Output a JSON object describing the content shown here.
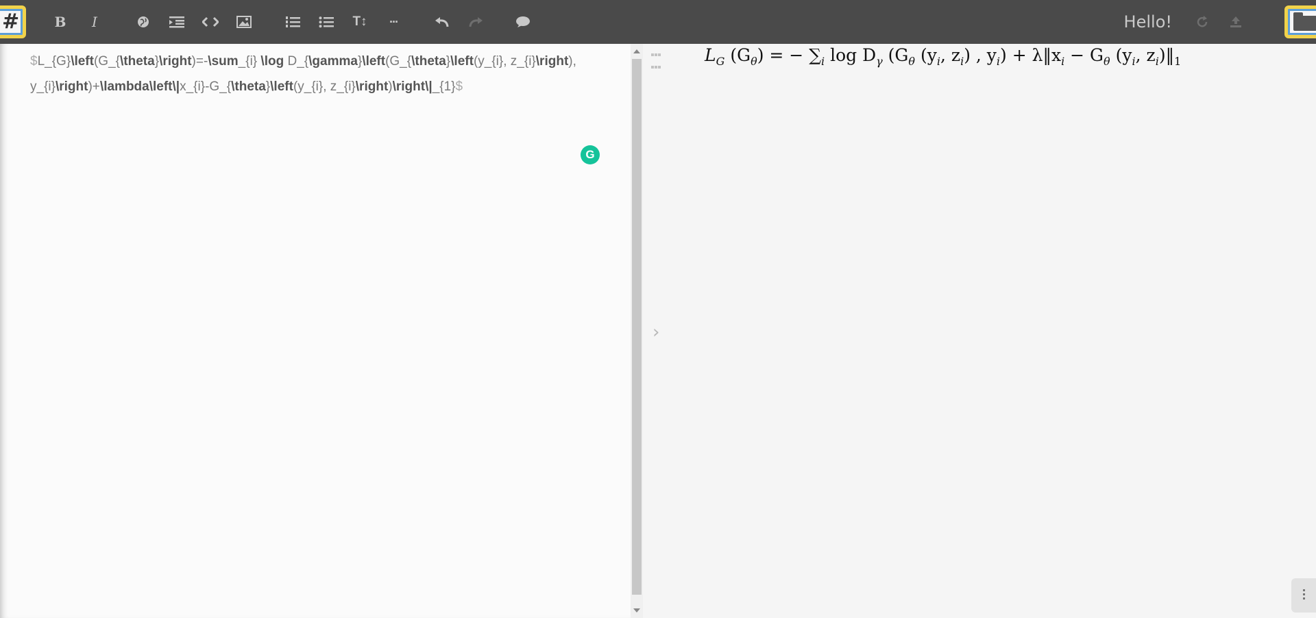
{
  "toolbar": {
    "buttons": [
      "bold",
      "italic",
      "link",
      "indent",
      "code",
      "image",
      "ordered-list",
      "bullet-list",
      "heading",
      "more",
      "undo",
      "redo",
      "comment"
    ],
    "bold_glyph": "B",
    "italic_glyph": "I",
    "heading_glyph": "T↕",
    "more_glyph": "···"
  },
  "corner_left": {
    "glyph": "#"
  },
  "greeting": "Hello!",
  "editor": {
    "segments": [
      {
        "t": "$",
        "c": "dollar"
      },
      {
        "t": "L_{G}",
        "c": ""
      },
      {
        "t": "\\left",
        "c": "kw"
      },
      {
        "t": "(G_{",
        "c": ""
      },
      {
        "t": "\\theta",
        "c": "kw"
      },
      {
        "t": "}",
        "c": ""
      },
      {
        "t": "\\right",
        "c": "kw"
      },
      {
        "t": ")=-",
        "c": ""
      },
      {
        "t": "\\sum",
        "c": "kw"
      },
      {
        "t": "_{i} ",
        "c": ""
      },
      {
        "t": "\\log",
        "c": "kw"
      },
      {
        "t": " D_{",
        "c": ""
      },
      {
        "t": "\\gamma",
        "c": "kw"
      },
      {
        "t": "}",
        "c": ""
      },
      {
        "t": "\\left",
        "c": "kw"
      },
      {
        "t": "(G_{",
        "c": ""
      },
      {
        "t": "\\theta",
        "c": "kw"
      },
      {
        "t": "}",
        "c": ""
      },
      {
        "t": "\\left",
        "c": "kw"
      },
      {
        "t": "(y_{i}, z_{i}",
        "c": ""
      },
      {
        "t": "\\right",
        "c": "kw"
      },
      {
        "t": "), y_{i}",
        "c": ""
      },
      {
        "t": "\\right",
        "c": "kw"
      },
      {
        "t": ")+",
        "c": ""
      },
      {
        "t": "\\lambda",
        "c": "kw"
      },
      {
        "t": "\\left\\|",
        "c": "kw"
      },
      {
        "t": "x_{i}-G_{",
        "c": ""
      },
      {
        "t": "\\theta",
        "c": "kw"
      },
      {
        "t": "}",
        "c": ""
      },
      {
        "t": "\\left",
        "c": "kw"
      },
      {
        "t": "(y_{i}, z_{i}",
        "c": ""
      },
      {
        "t": "\\right",
        "c": "kw"
      },
      {
        "t": ")",
        "c": ""
      },
      {
        "t": "\\right\\|",
        "c": "kw"
      },
      {
        "t": "_{1}",
        "c": ""
      },
      {
        "t": "$",
        "c": "dollar"
      }
    ]
  },
  "grammarly_glyph": "G",
  "preview": {
    "chevron": "›",
    "formula_parts": {
      "lhs": "L",
      "lhs_sub": "G",
      "open1": " (G",
      "theta": "θ",
      "rest1": ") = − ∑",
      "sum_sub": "i",
      "log": " log D",
      "gamma": "γ",
      "rest2": " (G",
      "theta2": "θ",
      "rest3": " (y",
      "yi": "i",
      "comma": ", z",
      "zi": "i",
      "rest4": ") , y",
      "yi2": "i",
      "rest5": ") + λ‖x",
      "xi": "i",
      "rest6": " − G",
      "theta3": "θ",
      "rest7": " (y",
      "yi3": "i",
      "comma2": ", z",
      "zi2": "i",
      "rest8": ")‖",
      "norm_sub": "1"
    }
  }
}
